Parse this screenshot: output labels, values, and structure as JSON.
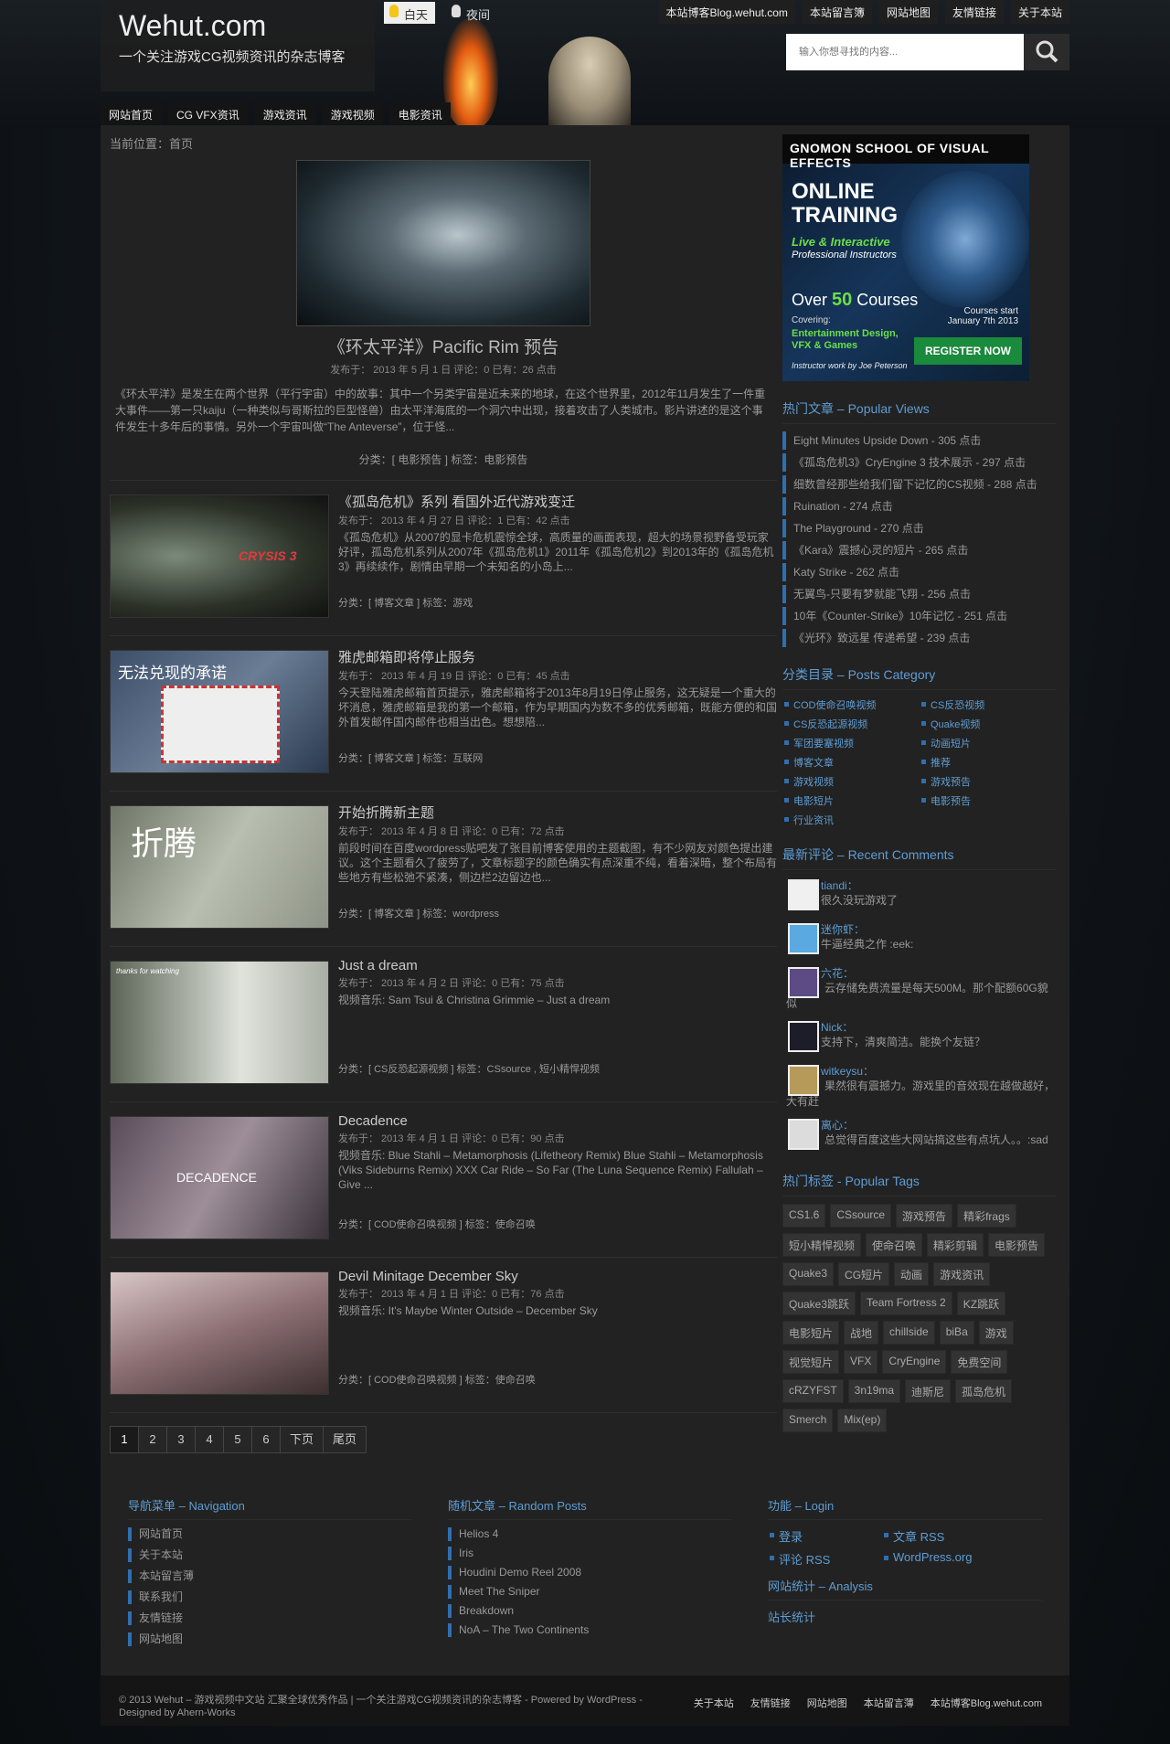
{
  "site": {
    "title": "Wehut.com",
    "description": "一个关注游戏CG视频资讯的杂志博客"
  },
  "modes": {
    "day": "白天",
    "night": "夜间"
  },
  "top_links": [
    "本站博客Blog.wehut.com",
    "本站留言簿",
    "网站地图",
    "友情链接",
    "关于本站"
  ],
  "search": {
    "placeholder": "输入你想寻找的内容..."
  },
  "nav": [
    "网站首页",
    "CG VFX资讯",
    "游戏资讯",
    "游戏视频",
    "电影资讯"
  ],
  "breadcrumb": "当前位置：首页",
  "featured": {
    "title": "《环太平洋》Pacific Rim 预告",
    "meta": "发布于： 2013 年 5 月 1 日  评论：0  已有：26 点击",
    "excerpt": "《环太平洋》是发生在两个世界（平行宇宙）中的故事：其中一个另类宇宙是近未来的地球，在这个世界里，2012年11月发生了一件重大事件——第一只kaiju（一种类似与哥斯拉的巨型怪兽）由太平洋海底的一个洞穴中出现，接着攻击了人类城市。影片讲述的是这个事件发生十多年后的事情。另外一个宇宙叫做“The Anteverse”，位于怪...",
    "cat": "分类：[ 电影预告 ]     标签：电影预告"
  },
  "posts": [
    {
      "title": "《孤岛危机》系列 看国外近代游戏变迁",
      "meta": "发布于： 2013 年 4 月 27 日  评论：1  已有：42 点击",
      "excerpt": "《孤岛危机》从2007的显卡危机震惊全球，高质量的画面表现，超大的场景视野备受玩家好评，孤岛危机系列从2007年《孤岛危机1》2011年《孤岛危机2》到2013年的《孤岛危机3》再续续作，剧情由早期一个未知名的小岛上...",
      "cat": "分类：[ 博客文章 ]     标签：游戏",
      "thumb_text": "CRYSIS 3"
    },
    {
      "title": "雅虎邮箱即将停止服务",
      "meta": "发布于： 2013 年 4 月 19 日  评论：0  已有：45 点击",
      "excerpt": "今天登陆雅虎邮箱首页提示，雅虎邮箱将于2013年8月19日停止服务，这无疑是一个重大的坏消息，雅虎邮箱是我的第一个邮箱，作为早期国内为数不多的优秀邮箱，既能方便的和国外首发邮件国内邮件也相当出色。想想陪...",
      "cat": "分类：[ 博客文章 ]     标签：互联网",
      "thumb_text": "无法兑现的承诺"
    },
    {
      "title": "开始折腾新主题",
      "meta": "发布于： 2013 年 4 月 8 日  评论：0  已有：72 点击",
      "excerpt": "前段时间在百度wordpress贴吧发了张目前博客使用的主题截图，有不少网友对颜色提出建议。这个主题看久了疲劳了，文章标题字的颜色确实有点深重不纯，看着深暗，整个布局有些地方有些松弛不紧凑，侧边栏2边留边也...",
      "cat": "分类：[ 博客文章 ]     标签：wordpress",
      "thumb_text": "折腾"
    },
    {
      "title": "Just a dream",
      "meta": "发布于： 2013 年 4 月 2 日  评论：0  已有：75 点击",
      "excerpt": "视频音乐: Sam Tsui & Christina Grimmie – Just a dream",
      "cat": "分类：[ CS反恐起源视频 ]     标签：CSsource , 短小精悍视频",
      "thumb_text": "thanks for watching"
    },
    {
      "title": "Decadence",
      "meta": "发布于： 2013 年 4 月 1 日  评论：0  已有：90 点击",
      "excerpt": "视频音乐: Blue Stahli – Metamorphosis (Lifetheory Remix) Blue Stahli – Metamorphosis (Viks Sideburns Remix) XXX Car Ride – So Far (The Luna Sequence Remix) Fallulah – Give ...",
      "cat": "分类：[ COD使命召唤视频 ]     标签：使命召唤",
      "thumb_text": "DECADENCE"
    },
    {
      "title": "Devil Minitage December Sky",
      "meta": "发布于： 2013 年 4 月 1 日  评论：0  已有：76 点击",
      "excerpt": "视频音乐: It's Maybe Winter Outside – December Sky",
      "cat": "分类：[ COD使命召唤视频 ]     标签：使命召唤",
      "thumb_text": ""
    }
  ],
  "pager": [
    "1",
    "2",
    "3",
    "4",
    "5",
    "6",
    "下页",
    "尾页"
  ],
  "ad": {
    "head": "GNOMON SCHOOL OF VISUAL EFFECTS",
    "title": "ONLINE TRAINING",
    "sub": "Live & Interactive",
    "sub2": "Professional Instructors",
    "courses_pre": "Over ",
    "courses_num": "50",
    "courses_post": " Courses",
    "covering": "Covering:",
    "covering2": "Entertainment Design, VFX & Games",
    "start": "Courses start January 7th 2013",
    "register": "REGISTER NOW",
    "credit": "Instructor work by Joe Peterson"
  },
  "popular": {
    "title": "热门文章 – Popular Views",
    "items": [
      "Eight Minutes Upside Down - 305 点击",
      "《孤岛危机3》CryEngine 3 技术展示 - 297 点击",
      "细数曾经那些给我们留下记忆的CS视频 - 288 点击",
      "Ruination - 274 点击",
      "The Playground - 270 点击",
      "《Kara》震撼心灵的短片 - 265 点击",
      "Katy Strike - 262 点击",
      "无翼鸟-只要有梦就能飞翔 - 256 点击",
      "10年《Counter-Strike》10年记忆 - 251 点击",
      "《光环》致远星 传递希望 - 239 点击"
    ]
  },
  "categories": {
    "title": "分类目录 – Posts Category",
    "items": [
      "COD使命召唤视频",
      "CS反恐视频",
      "CS反恐起源视频",
      "Quake视频",
      "军团要塞视频",
      "动画短片",
      "博客文章",
      "推荐",
      "游戏视频",
      "游戏预告",
      "电影短片",
      "电影预告",
      "行业资讯"
    ]
  },
  "comments": {
    "title": "最新评论 – Recent Comments",
    "items": [
      {
        "author": "tiandi：",
        "text": "很久没玩游戏了",
        "color": "#f0f0f0"
      },
      {
        "author": "迷你虾：",
        "text": "牛逼经典之作 :eek:",
        "color": "#5aa9e0"
      },
      {
        "author": "六花：",
        "text": "云存储免费流量是每天500M。那个配额60G貌似",
        "color": "#5d4b86"
      },
      {
        "author": "Nick：",
        "text": "支持下，清爽简洁。能换个友链？",
        "color": "#1d1d2a"
      },
      {
        "author": "witkeysu：",
        "text": "果然很有震撼力。游戏里的音效现在越做越好，大有赶",
        "color": "#b59a5a"
      },
      {
        "author": "离心：",
        "text": "总觉得百度这些大网站搞这些有点坑人。。:sad",
        "color": "#dcdcdc"
      }
    ]
  },
  "tags": {
    "title": "热门标签 - Popular Tags",
    "items": [
      "CS1.6",
      "CSsource",
      "游戏预告",
      "精彩frags",
      "短小精悍视频",
      "使命召唤",
      "精彩剪辑",
      "电影预告",
      "Quake3",
      "CG短片",
      "动画",
      "游戏资讯",
      "Quake3跳跃",
      "Team Fortress 2",
      "KZ跳跃",
      "电影短片",
      "战地",
      "chillside",
      "biBa",
      "游戏",
      "视觉短片",
      "VFX",
      "CryEngine",
      "免费空间",
      "cRZYFST",
      "3n19ma",
      "迪斯尼",
      "孤岛危机",
      "Smerch",
      "Mix(ep)"
    ]
  },
  "footer_nav": {
    "title": "导航菜单 – Navigation",
    "items": [
      "网站首页",
      "关于本站",
      "本站留言薄",
      "联系我们",
      "友情链接",
      "网站地图"
    ]
  },
  "footer_random": {
    "title": "随机文章 – Random Posts",
    "items": [
      "Helios 4",
      "Iris",
      "Houdini Demo Reel 2008",
      "Meet The Sniper",
      "Breakdown",
      "NoA – The Two Continents"
    ]
  },
  "footer_login": {
    "title": "功能 – Login",
    "items": [
      "登录",
      "文章 RSS",
      "评论 RSS",
      "WordPress.org"
    ],
    "analysis": "网站统计 – Analysis",
    "stats": "站长统计"
  },
  "footer": {
    "copyright": "© 2013   Wehut – 游戏视频中文站 汇聚全球优秀作品 | 一个关注游戏CG视频资讯的杂志博客 - Powered by WordPress - Designed by Ahern-Works",
    "links": [
      "关于本站",
      "友情链接",
      "网站地图",
      "本站留言薄",
      "本站博客Blog.wehut.com"
    ]
  }
}
